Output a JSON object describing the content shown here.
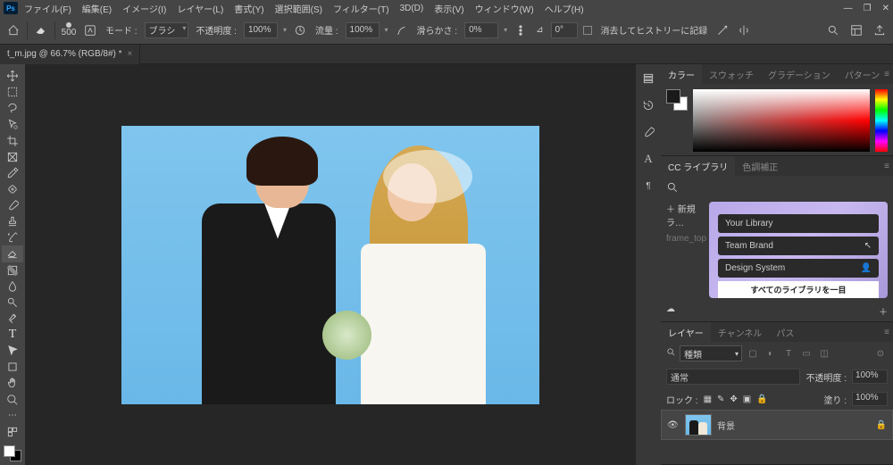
{
  "menu": {
    "items": [
      "ファイル(F)",
      "編集(E)",
      "イメージ(I)",
      "レイヤー(L)",
      "書式(Y)",
      "選択範囲(S)",
      "フィルター(T)",
      "3D(D)",
      "表示(V)",
      "ウィンドウ(W)",
      "ヘルプ(H)"
    ]
  },
  "opt": {
    "brush_size": "500",
    "mode_label": "モード :",
    "mode_value": "ブラシ",
    "opacity_label": "不透明度 :",
    "opacity_value": "100%",
    "flow_label": "流量 :",
    "flow_value": "100%",
    "smoothing_label": "滑らかさ :",
    "smoothing_value": "0%",
    "angle_label": "⊿",
    "angle_value": "0°",
    "history_label": "消去してヒストリーに記録"
  },
  "tab": {
    "title": "t_m.jpg @ 66.7% (RGB/8#) *"
  },
  "panels": {
    "color": {
      "tabs": [
        "カラー",
        "スウォッチ",
        "グラデーション",
        "パターン"
      ]
    },
    "lib": {
      "tabs": [
        "CC ライブラリ",
        "色調補正"
      ],
      "new": "新規ラ…",
      "asset": "frame_top",
      "cards": [
        "Your Library",
        "Team Brand",
        "Design System"
      ],
      "footer": "すべてのライブラリを一目"
    },
    "layer": {
      "tabs": [
        "レイヤー",
        "チャンネル",
        "パス"
      ],
      "kind": "種類",
      "blend": "通常",
      "opacity_l": "不透明度 :",
      "opacity_v": "100%",
      "lock_l": "ロック :",
      "fill_l": "塗り :",
      "fill_v": "100%",
      "layer_name": "背景"
    }
  }
}
